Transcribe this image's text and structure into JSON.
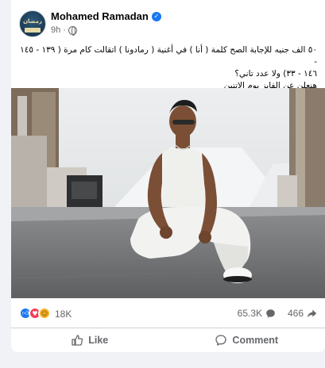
{
  "post": {
    "author": "Mohamed Ramadan",
    "time": "9h",
    "separator": "·",
    "text_lines": [
      "٥٠ الف جنيه للإجابة الصح كلمة ( أنا ) في أغنية ( رمادونا ) اتقالت كام مرة ( ١٣٩ - ١٤٥ -",
      "١٤٦ - ٣٣) ولا عدد تاني؟",
      "هنعلن عن الفايز يوم الاتنين"
    ]
  },
  "avatar": {
    "logo_text": "رمضان"
  },
  "stats": {
    "reactions_count": "18K",
    "comments_count": "65.3K",
    "shares_count": "466"
  },
  "actions": {
    "like_label": "Like",
    "comment_label": "Comment"
  },
  "icons": {
    "verified": "verified-badge-icon",
    "globe": "globe-icon",
    "like": "thumbs-up-icon",
    "comment": "comment-bubble-icon",
    "share": "share-arrow-icon"
  },
  "colors": {
    "brand_blue": "#1877f2",
    "love_red": "#f33e58",
    "haha_yellow": "#f7b125",
    "muted_text": "#65676b"
  }
}
